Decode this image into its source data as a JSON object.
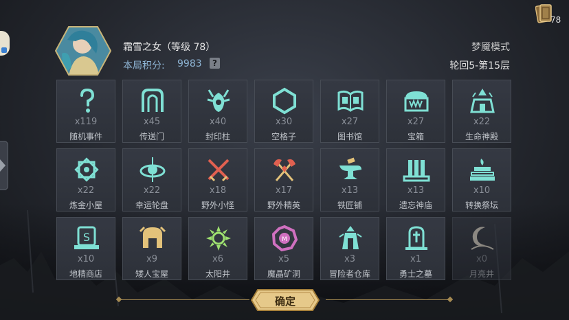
{
  "header": {
    "hero_name": "霜雪之女（等级 78）",
    "score_label": "本局积分:",
    "score_value": "9983",
    "help_label": "?",
    "mode": "梦魇模式",
    "floor": "轮回5-第15层",
    "cards_count": "78"
  },
  "tiles": [
    {
      "count": "x119",
      "label": "随机事件",
      "icon": "question-icon"
    },
    {
      "count": "x45",
      "label": "传送门",
      "icon": "portal-icon"
    },
    {
      "count": "x40",
      "label": "封印柱",
      "icon": "seal-pillar-icon"
    },
    {
      "count": "x30",
      "label": "空格子",
      "icon": "hexagon-icon"
    },
    {
      "count": "x27",
      "label": "图书馆",
      "icon": "book-icon"
    },
    {
      "count": "x27",
      "label": "宝箱",
      "icon": "chest-icon"
    },
    {
      "count": "x22",
      "label": "生命神殿",
      "icon": "temple-icon"
    },
    {
      "count": "x22",
      "label": "炼金小屋",
      "icon": "alchemy-icon"
    },
    {
      "count": "x22",
      "label": "幸运轮盘",
      "icon": "wheel-icon"
    },
    {
      "count": "x18",
      "label": "野外小怪",
      "icon": "crossed-swords-icon"
    },
    {
      "count": "x17",
      "label": "野外精英",
      "icon": "crossed-axes-icon"
    },
    {
      "count": "x13",
      "label": "铁匠铺",
      "icon": "anvil-icon"
    },
    {
      "count": "x13",
      "label": "遗忘神庙",
      "icon": "shrine-icon"
    },
    {
      "count": "x10",
      "label": "转换祭坛",
      "icon": "altar-icon"
    },
    {
      "count": "x10",
      "label": "地精商店",
      "icon": "shop-icon"
    },
    {
      "count": "x9",
      "label": "矮人宝屋",
      "icon": "dwarf-helmet-icon"
    },
    {
      "count": "x6",
      "label": "太阳井",
      "icon": "sun-icon"
    },
    {
      "count": "x5",
      "label": "魔晶矿洞",
      "icon": "crystal-mine-icon"
    },
    {
      "count": "x3",
      "label": "冒险者仓库",
      "icon": "warehouse-icon"
    },
    {
      "count": "x1",
      "label": "勇士之墓",
      "icon": "tomb-icon"
    },
    {
      "count": "x0",
      "label": "月亮井",
      "icon": "moon-icon"
    }
  ],
  "footer": {
    "confirm_label": "确定"
  },
  "colors": {
    "teal_icon": "#7fe0d4",
    "gold": "#e3c27a",
    "pink": "#d070c0",
    "accent_blue": "#8fb6d6"
  }
}
